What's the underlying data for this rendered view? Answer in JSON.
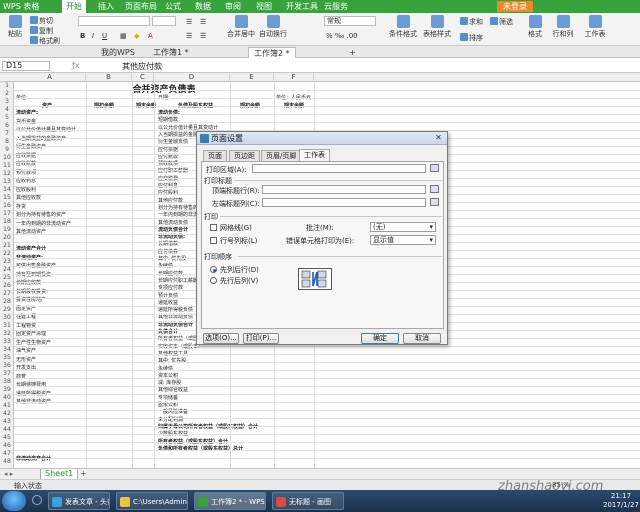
{
  "app": {
    "title": "WPS 表格"
  },
  "menubar": {
    "items": [
      "开始",
      "插入",
      "页面布局",
      "公式",
      "数据",
      "审阅",
      "视图",
      "开发工具",
      "云服务"
    ],
    "active": "开始",
    "unsynced": "未登录"
  },
  "ribbon": {
    "paste": "粘贴",
    "cut": "剪切",
    "copy": "复制",
    "format_painter": "格式刷",
    "font_size_value": "",
    "number_format": "常规",
    "merge": "合并居中",
    "wrap": "自动换行",
    "conditional": "条件格式",
    "table_style": "表格样式",
    "sum": "求和",
    "filter": "筛选",
    "sort": "排序",
    "format": "格式",
    "rowcol": "行和列",
    "worksheet": "工作表"
  },
  "doctabs": {
    "tabs": [
      {
        "label": "我的WPS"
      },
      {
        "label": "工作簿1 *"
      },
      {
        "label": "工作簿2 *"
      }
    ],
    "add": "+"
  },
  "formula": {
    "cell_ref": "D15",
    "content": "其他应付款"
  },
  "columns": [
    "A",
    "B",
    "C",
    "D",
    "E",
    "F"
  ],
  "rows": [
    "1",
    "2",
    "3",
    "4",
    "5",
    "6",
    "7",
    "8",
    "9",
    "10",
    "11",
    "12",
    "13",
    "14",
    "15",
    "16",
    "17",
    "18",
    "19",
    "20",
    "21",
    "22",
    "23",
    "24",
    "25",
    "26",
    "27",
    "28",
    "29",
    "30",
    "31",
    "32",
    "33",
    "34",
    "35",
    "36",
    "37",
    "38",
    "39",
    "40",
    "41",
    "42",
    "43",
    "44",
    "45",
    "46",
    "47",
    "48"
  ],
  "sheet": {
    "title": "合并资产负债表",
    "unit_left": "单位:",
    "date_label": "日期:",
    "unit_right": "单位：人民币元",
    "headers": [
      "资产",
      "期初余额",
      "期末余额",
      "负债及股东权益",
      "期初余额",
      "期末余额"
    ],
    "left_col": [
      "流动资产:",
      "货币资金",
      "以公允价值计量且其变动计",
      "入当期损益的金融资产",
      "衍生金融资产",
      "应收票据",
      "应收账款",
      "预付款项",
      "应收利息",
      "应收股利",
      "其他应收款",
      "存货",
      "划分为持有待售的资产",
      "一年内到期的非流动资产",
      "其他流动资产",
      "",
      "流动资产合计",
      "非流动资产:",
      "可供出售金融资产",
      "持有至到期投资",
      "长期应收款",
      "长期股权投资",
      "投资性房地产",
      "固定资产",
      "在建工程",
      "工程物资",
      "固定资产清理",
      "生产性生物资产",
      "油气资产",
      "无形资产",
      "开发支出",
      "商誉",
      "长期待摊费用",
      "递延所得税资产",
      "其他非流动资产"
    ],
    "right_col": [
      "流动负债:",
      "短期借款",
      "以公允价值计量且其变动计",
      "入当期损益的金融负债",
      "衍生金融负债",
      "应付票据",
      "应付账款",
      "预收款项",
      "应付职工薪酬",
      "应交税费",
      "应付利息",
      "应付股利",
      "其他应付款",
      "划分为持有待售的负债",
      "一年内到期的非流动负债",
      "其他流动负债",
      "流动负债合计",
      "非流动负债:",
      "长期借款",
      "应付债券",
      "其中: 优先股",
      "永续债",
      "长期应付款",
      "长期应付职工薪酬",
      "专项应付款",
      "预计负债",
      "递延收益",
      "递延所得税负债",
      "其他非流动负债",
      "非流动负债合计",
      "负债合计",
      "所有者权益（或股东权益）",
      "实收资本（或股本）",
      "其他权益工具",
      "其中: 优先股",
      "永续债",
      "资本公积",
      "减: 库存股",
      "其他综合收益",
      "专项储备",
      "盈余公积",
      "一般风险准备",
      "未分配利润",
      "归属于母公司所有者权益（或股东权益）合计",
      "少数股东权益",
      "所有者权益（或股东权益）合计",
      "负债和所有者权益（或股东权益）总计"
    ],
    "bottom_left": "非流动资产合计",
    "bottom_left2": "资产总计"
  },
  "sheetbar": {
    "tab": "Sheet1"
  },
  "status": {
    "text": "输入状态",
    "zoom": "85 %"
  },
  "dialog": {
    "title": "页面设置",
    "tabs": [
      "页面",
      "页边距",
      "页眉/页脚",
      "工作表"
    ],
    "active_tab": "工作表",
    "print_area_label": "打印区域(A):",
    "print_titles_label": "打印标题",
    "top_rows_label": "顶端标题行(R):",
    "left_cols_label": "左端标题列(C):",
    "print_group": "打印",
    "gridlines_label": "网格线(G)",
    "rowcol_label": "行号列标(L)",
    "comments_label": "批注(M):",
    "comments_value": "(无)",
    "errors_label": "错误单元格打印为(E):",
    "errors_value": "显示值",
    "order_group": "打印顺序",
    "down_then_over": "先列后行(D)",
    "over_then_down": "先行后列(V)",
    "options_btn": "选项(O)...",
    "print_btn": "打印(P)...",
    "ok_btn": "确定",
    "cancel_btn": "取消"
  },
  "taskbar": {
    "items": [
      "发表文章 - 头条...",
      "C:\\Users\\Admini...",
      "工作簿2 * - WPS ...",
      "无标题 - 画图"
    ],
    "time": "21:17",
    "date": "2017/1/27"
  },
  "watermark": "zhanshaoyi.com",
  "colors": {
    "wps_green": "#38a23c",
    "highlight_red": "#d0262a",
    "accent_blue": "#1a5bbf"
  }
}
